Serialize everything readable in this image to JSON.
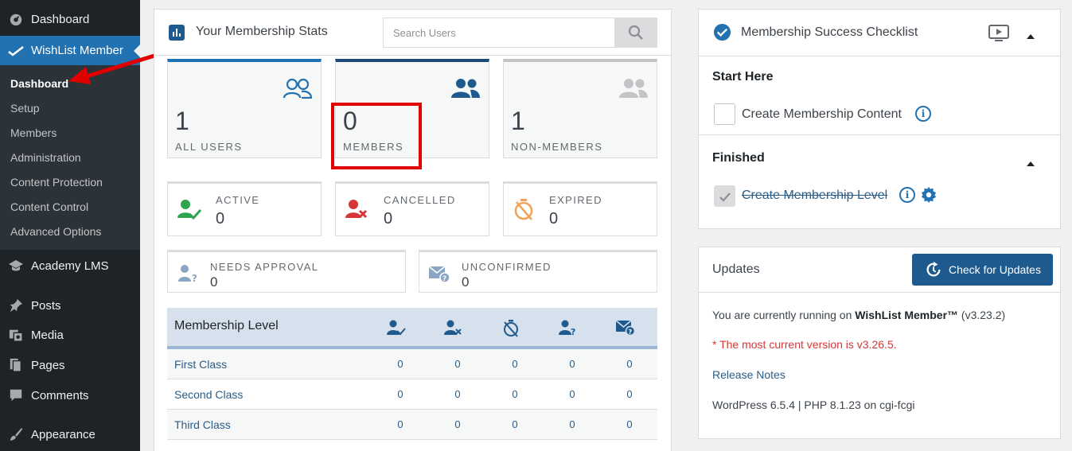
{
  "sidebar": {
    "dashboard": "Dashboard",
    "wishlist": "WishList Member",
    "submenu": [
      "Dashboard",
      "Setup",
      "Members",
      "Administration",
      "Content Protection",
      "Content Control",
      "Advanced Options"
    ],
    "academy": "Academy LMS",
    "posts": "Posts",
    "media": "Media",
    "pages": "Pages",
    "comments": "Comments",
    "appearance": "Appearance"
  },
  "stats": {
    "title": "Your Membership Stats",
    "search_placeholder": "Search Users",
    "all_users": {
      "value": "1",
      "label": "ALL USERS"
    },
    "members": {
      "value": "0",
      "label": "MEMBERS"
    },
    "non_members": {
      "value": "1",
      "label": "NON-MEMBERS"
    },
    "active": {
      "value": "0",
      "label": "ACTIVE"
    },
    "cancelled": {
      "value": "0",
      "label": "CANCELLED"
    },
    "expired": {
      "value": "0",
      "label": "EXPIRED"
    },
    "needs_approval": {
      "value": "0",
      "label": "NEEDS APPROVAL"
    },
    "unconfirmed": {
      "value": "0",
      "label": "UNCONFIRMED"
    }
  },
  "levels": {
    "header": "Membership Level",
    "rows": [
      {
        "name": "First Class",
        "vals": [
          "0",
          "0",
          "0",
          "0",
          "0"
        ]
      },
      {
        "name": "Second Class",
        "vals": [
          "0",
          "0",
          "0",
          "0",
          "0"
        ]
      },
      {
        "name": "Third Class",
        "vals": [
          "0",
          "0",
          "0",
          "0",
          "0"
        ]
      }
    ]
  },
  "checklist": {
    "title": "Membership Success Checklist",
    "start_here": "Start Here",
    "item1": "Create Membership Content",
    "finished": "Finished",
    "item2": "Create Membership Level"
  },
  "updates": {
    "title": "Updates",
    "button": "Check for Updates",
    "running_prefix": "You are currently running on ",
    "running_product": "WishList Member™",
    "running_version": " (v3.23.2)",
    "current_version": "* The most current version is v3.26.5.",
    "release_notes": "Release Notes",
    "environment": "WordPress 6.5.4 | PHP 8.1.23 on cgi-fcgi"
  },
  "colors": {
    "accent": "#2271b1",
    "sidebar": "#1d2327",
    "highlight": "#e00000",
    "warning": "#d63638"
  }
}
